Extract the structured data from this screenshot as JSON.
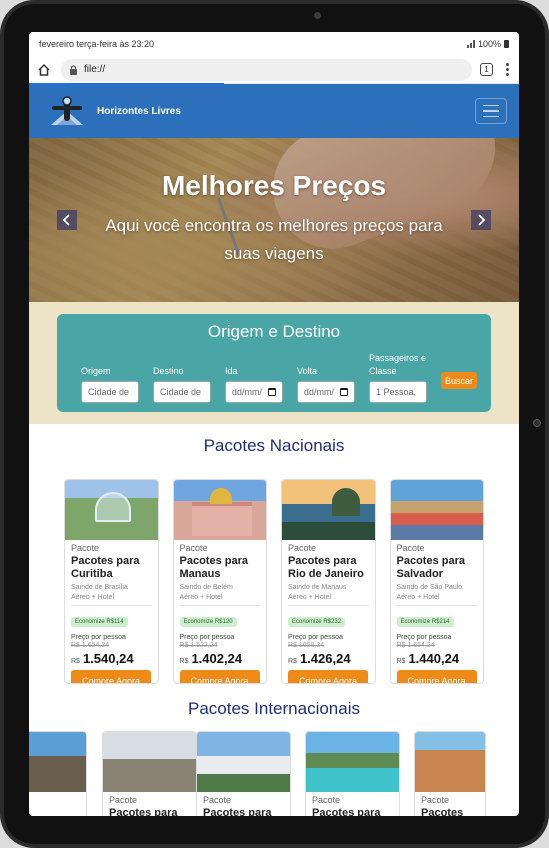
{
  "status_bar": {
    "time": "fevereiro terça-feira às 23:20",
    "battery": "100%"
  },
  "browser": {
    "url": "file://",
    "tab_count": "1"
  },
  "navbar": {
    "brand": "Horizontes Livres"
  },
  "hero": {
    "title": "Melhores Preços",
    "subtitle": "Aqui você encontra os melhores preços para suas viagens"
  },
  "search": {
    "title": "Origem e Destino",
    "origin_label": "Origem",
    "origin_placeholder": "Cidade de",
    "dest_label": "Destino",
    "dest_placeholder": "Cidade de",
    "departure_label": "Ida",
    "departure_placeholder": "dd/mm/",
    "return_label": "Volta",
    "return_placeholder": "dd/mm/",
    "pax_label": "Passageiros e Classe",
    "pax_value": "1 Pessoa,",
    "button": "Buscar"
  },
  "national": {
    "title": "Pacotes Nacionais",
    "packages": [
      {
        "kicker": "Pacote",
        "title": "Pacotes para Curitiba",
        "from": "Saindo de Brasília",
        "type": "Aéreo + Hotel",
        "badge": "Economize R$114",
        "per_person": "Preço por pessoa",
        "old": "R$ 1.654,24",
        "currency": "R$",
        "price": "1.540,24",
        "cta": "Compre Agora"
      },
      {
        "kicker": "Pacote",
        "title": "Pacotes para Manaus",
        "from": "Saindo de Belém",
        "type": "Aéreo + Hotel",
        "badge": "Economize R$120",
        "per_person": "Preço por pessoa",
        "old": "R$ 1.522,24",
        "currency": "R$",
        "price": "1.402,24",
        "cta": "Compre Agora"
      },
      {
        "kicker": "Pacote",
        "title": "Pacotes para Rio de Janeiro",
        "from": "Saindo de Manaus",
        "type": "Aéreo + Hotel",
        "badge": "Economize R$232",
        "per_person": "Preço por pessoa",
        "old": "R$ 1658,24",
        "currency": "R$",
        "price": "1.426,24",
        "cta": "Compre Agora"
      },
      {
        "kicker": "Pacote",
        "title": "Pacotes para Salvador",
        "from": "Saindo de São Paulo",
        "type": "Aéreo + Hotel",
        "badge": "Economize R$214",
        "per_person": "Preço por pessoa",
        "old": "R$ 1.654,24",
        "currency": "R$",
        "price": "1.440,24",
        "cta": "Compre Agora"
      }
    ]
  },
  "international": {
    "title": "Pacotes Internacionais",
    "packages": [
      {
        "kicker": "Pacote",
        "title": "Pacotes para"
      },
      {
        "kicker": "Pacote",
        "title": "Pacotes para"
      },
      {
        "kicker": "Pacote",
        "title": "Pacotes para"
      },
      {
        "kicker": "Pacote",
        "title": "Pacotes para"
      }
    ]
  },
  "colors": {
    "navbar": "#2c6fba",
    "accent": "#ee8a17",
    "search_card": "#4aa6a6",
    "section_title": "#1e2e7a"
  }
}
